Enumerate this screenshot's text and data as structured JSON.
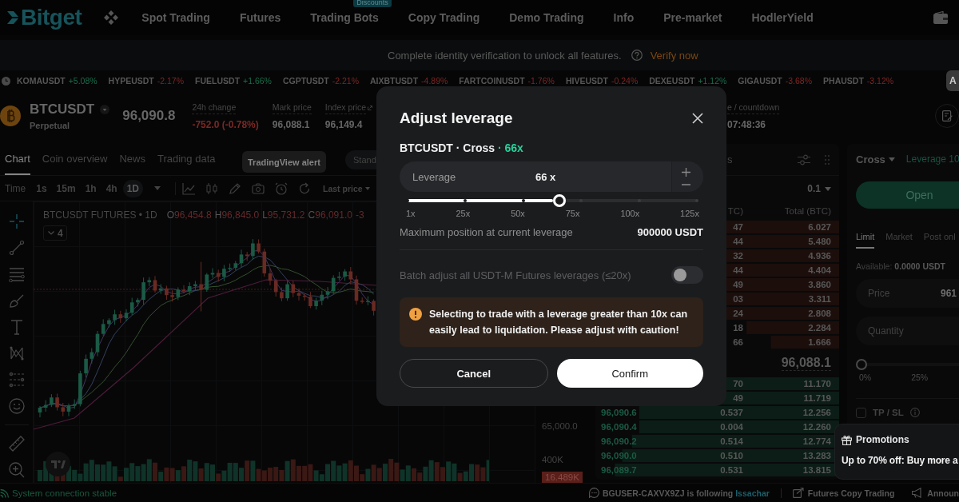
{
  "nav": {
    "logo": "Bitget",
    "items": [
      {
        "label": "Spot Trading"
      },
      {
        "label": "Futures"
      },
      {
        "label": "Trading Bots",
        "badge": "Discounts"
      },
      {
        "label": "Copy Trading"
      },
      {
        "label": "Demo Trading"
      },
      {
        "label": "Info"
      },
      {
        "label": "Pre-market"
      },
      {
        "label": "HodlerYield"
      }
    ]
  },
  "notice": {
    "text": "Complete identity verification to unlock all features.",
    "action": "Verify now"
  },
  "ticker": {
    "items": [
      {
        "symbol": "KOMAUSDT",
        "change": "+5.08%",
        "color": "#1d6b4a"
      },
      {
        "symbol": "HYPEUSDT",
        "change": "-2.17%",
        "color": "#7a2824"
      },
      {
        "symbol": "FUELUSDT",
        "change": "+1.66%",
        "color": "#1d6b4a"
      },
      {
        "symbol": "CGPTUSDT",
        "change": "-2.21%",
        "color": "#7a2824"
      },
      {
        "symbol": "AIXBTUSDT",
        "change": "-4.89%",
        "color": "#7a2824"
      },
      {
        "symbol": "FARTCOINUSDT",
        "change": "-1.76%",
        "color": "#7a2824"
      },
      {
        "symbol": "HIVEUSDT",
        "change": "-0.24%",
        "color": "#7a2824"
      },
      {
        "symbol": "DEXEUSDT",
        "change": "+1.12%",
        "color": "#1d6b4a"
      },
      {
        "symbol": "GIGAUSDT",
        "change": "-3.68%",
        "color": "#7a2824"
      },
      {
        "symbol": "PHAUSDT",
        "change": "-3.12%",
        "color": "#7a2824"
      }
    ],
    "side_tab": "A"
  },
  "symbol_bar": {
    "symbol": "BTCUSDT",
    "contract": "Perpetual",
    "last_price": "96,090.8",
    "stats": [
      {
        "label": "24h change",
        "value": "-752.0 (-0.78%)",
        "color": "#7a2824"
      },
      {
        "label": "Mark price",
        "value": "96,088.1",
        "color": "#656565"
      },
      {
        "label": "Index price",
        "value": "96,149.4",
        "color": "#656565"
      }
    ],
    "funding": {
      "label": "e / countdown",
      "value": "07:48:36"
    }
  },
  "chart_panel": {
    "tabs": [
      {
        "label": "Chart",
        "selected": true
      },
      {
        "label": "Coin overview",
        "selected": false
      },
      {
        "label": "News",
        "selected": false
      },
      {
        "label": "Trading data",
        "selected": false
      }
    ],
    "tooltip": "TradingView alert",
    "style_button": "Stand",
    "toolbar": {
      "time_label": "Time",
      "intervals": [
        {
          "label": "1s",
          "selected": false
        },
        {
          "label": "15m",
          "selected": false
        },
        {
          "label": "1h",
          "selected": false
        },
        {
          "label": "4h",
          "selected": false
        },
        {
          "label": "1D",
          "selected": true
        }
      ],
      "price_source": "Last price"
    },
    "legend": {
      "title": "BTCUSDT FUTURES • 1D",
      "ohlc": [
        {
          "key": "O",
          "value": "96,454.8"
        },
        {
          "key": "H",
          "value": "96,845.0"
        },
        {
          "key": "L",
          "value": "95,731.2"
        },
        {
          "key": "C",
          "value": "96,091.0"
        }
      ],
      "change": "-3",
      "indicators": "4"
    },
    "price_axis": "65,000.0",
    "volume_axis": "400K",
    "volume_tag": "16.489K"
  },
  "order_book": {
    "title": "s",
    "precision": "0.1",
    "columns": [
      "TC)",
      "Total (BTC)"
    ],
    "asks": [
      {
        "amount": "47",
        "total": "6.027"
      },
      {
        "amount": "44",
        "total": "5.480"
      },
      {
        "amount": "32",
        "total": "4.936"
      },
      {
        "amount": "44",
        "total": "4.404"
      },
      {
        "amount": "49",
        "total": "3.860"
      },
      {
        "amount": "03",
        "total": "3.311"
      },
      {
        "amount": "24",
        "total": "2.808"
      },
      {
        "amount": "18",
        "total": "2.284"
      },
      {
        "amount": "66",
        "total": "1.666"
      }
    ],
    "mid_price": "96,088.1",
    "bids": [
      {
        "amount": "70",
        "total": "11.170"
      },
      {
        "amount": "49",
        "total": "11.719"
      },
      {
        "price": "96,090.6",
        "amount": "0.537",
        "total": "12.256"
      },
      {
        "price": "96,090.4",
        "amount": "0.004",
        "total": "12.260"
      },
      {
        "price": "96,090.2",
        "amount": "0.514",
        "total": "12.774"
      },
      {
        "price": "96,090.0",
        "amount": "0.510",
        "total": "13.283"
      },
      {
        "price": "96,089.7",
        "amount": "0.531",
        "total": "13.815"
      }
    ]
  },
  "order_form": {
    "margin_mode": "Cross",
    "leverage": "Leverage 10",
    "submit": "Open",
    "tabs": [
      {
        "label": "Limit",
        "selected": true
      },
      {
        "label": "Market",
        "selected": false
      },
      {
        "label": "Post onl",
        "selected": false
      }
    ],
    "available_label": "Available:",
    "available_value": "0.0000 USDT",
    "price_field": {
      "label": "Price",
      "value": "961"
    },
    "quantity_field": {
      "placeholder": "Quantity"
    },
    "slider": {
      "level": 0,
      "marks": [
        "0%",
        "25%"
      ]
    },
    "tpsl": {
      "label": "TP / SL",
      "checked": false
    }
  },
  "promotions": {
    "title": "Promotions",
    "text": "Up to 70% off: Buy more a"
  },
  "status_bar": {
    "connection": "System connection stable",
    "activity": {
      "text": "BGUSER-CAXVX9ZJ is following",
      "link": "Issachar"
    },
    "links": [
      "Futures Copy Trading",
      "Announ"
    ]
  },
  "modal": {
    "title": "Adjust leverage",
    "pair": "BTCUSDT · Cross",
    "leverage_tag": "· 66x",
    "input": {
      "label": "Leverage",
      "value": "66 x"
    },
    "slider": {
      "level": 0.524,
      "ticks": [
        "1x",
        "25x",
        "50x",
        "75x",
        "100x",
        "125x"
      ]
    },
    "max_position": {
      "label": "Maximum position at current leverage",
      "value": "900000 USDT"
    },
    "batch": {
      "label": "Batch adjust all USDT-M Futures leverages (≤20x)",
      "on": false
    },
    "warning": "Selecting to trade with a leverage greater than 10x can easily lead to liquidation. Please adjust with caution!",
    "buttons": [
      {
        "label": "Cancel",
        "kind": "secondary"
      },
      {
        "label": "Confirm",
        "kind": "primary"
      }
    ]
  }
}
